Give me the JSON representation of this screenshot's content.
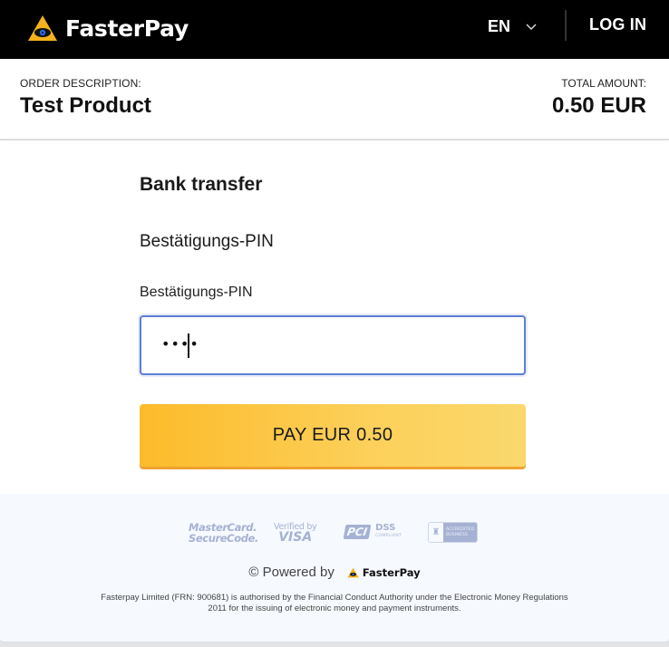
{
  "header": {
    "brand": "FasterPay",
    "logo_icon": "eye-triangle-icon",
    "language": "EN",
    "language_icon": "chevron-down-icon",
    "login_label": "LOG IN"
  },
  "order": {
    "description_label": "ORDER DESCRIPTION:",
    "description_value": "Test Product",
    "total_label": "TOTAL AMOUNT:",
    "total_value": "0.50 EUR"
  },
  "form": {
    "method_title": "Bank transfer",
    "field_heading": "Bestätigungs-PIN",
    "field_label": "Bestätigungs-PIN",
    "pin_masked_value": "••••",
    "pay_button_label": "PAY EUR 0.50"
  },
  "colors": {
    "accent_yellow": "#fcbb2a",
    "input_focus_border": "#5b7fd4",
    "header_bg": "#000000",
    "footer_bg": "#f6f9fe"
  },
  "footer": {
    "badges": {
      "mastercard_line1": "MasterCard.",
      "mastercard_line2": "SecureCode.",
      "visa_line1": "Verified by",
      "visa_line2": "VISA",
      "pci_logo": "PCI",
      "pci_dss": "DSS",
      "pci_compliant": "COMPLIANT",
      "bbb_seal": "BBB",
      "bbb_line1": "ACCREDITED",
      "bbb_line2": "BUSINESS"
    },
    "powered_by": "© Powered by",
    "powered_brand": "FasterPay",
    "legal_text": "Fasterpay Limited (FRN: 900681) is authorised by the Financial Conduct Authority under the Electronic Money Regulations 2011 for the issuing of electronic money and payment instruments."
  }
}
